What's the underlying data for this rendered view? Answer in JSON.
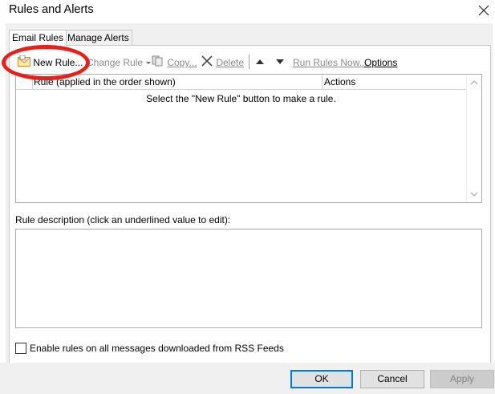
{
  "window": {
    "title": "Rules and Alerts"
  },
  "tabs": [
    {
      "label": "Email Rules",
      "active": true
    },
    {
      "label": "Manage Alerts",
      "active": false
    }
  ],
  "toolbar": {
    "new_rule": "New Rule...",
    "change_rule": "Change Rule",
    "copy": "Copy...",
    "delete": "Delete",
    "run_rules_now": "Run Rules Now...",
    "options": "Options"
  },
  "rules_list": {
    "columns": [
      "Rule (applied in the order shown)",
      "Actions"
    ],
    "empty_message": "Select the \"New Rule\" button to make a rule."
  },
  "description": {
    "label": "Rule description (click an underlined value to edit):"
  },
  "rss": {
    "label": "Enable rules on all messages downloaded from RSS Feeds",
    "checked": false
  },
  "buttons": {
    "ok": "OK",
    "cancel": "Cancel",
    "apply": "Apply"
  },
  "colors": {
    "annotation": "#e8201a",
    "accent": "#0078d7"
  }
}
